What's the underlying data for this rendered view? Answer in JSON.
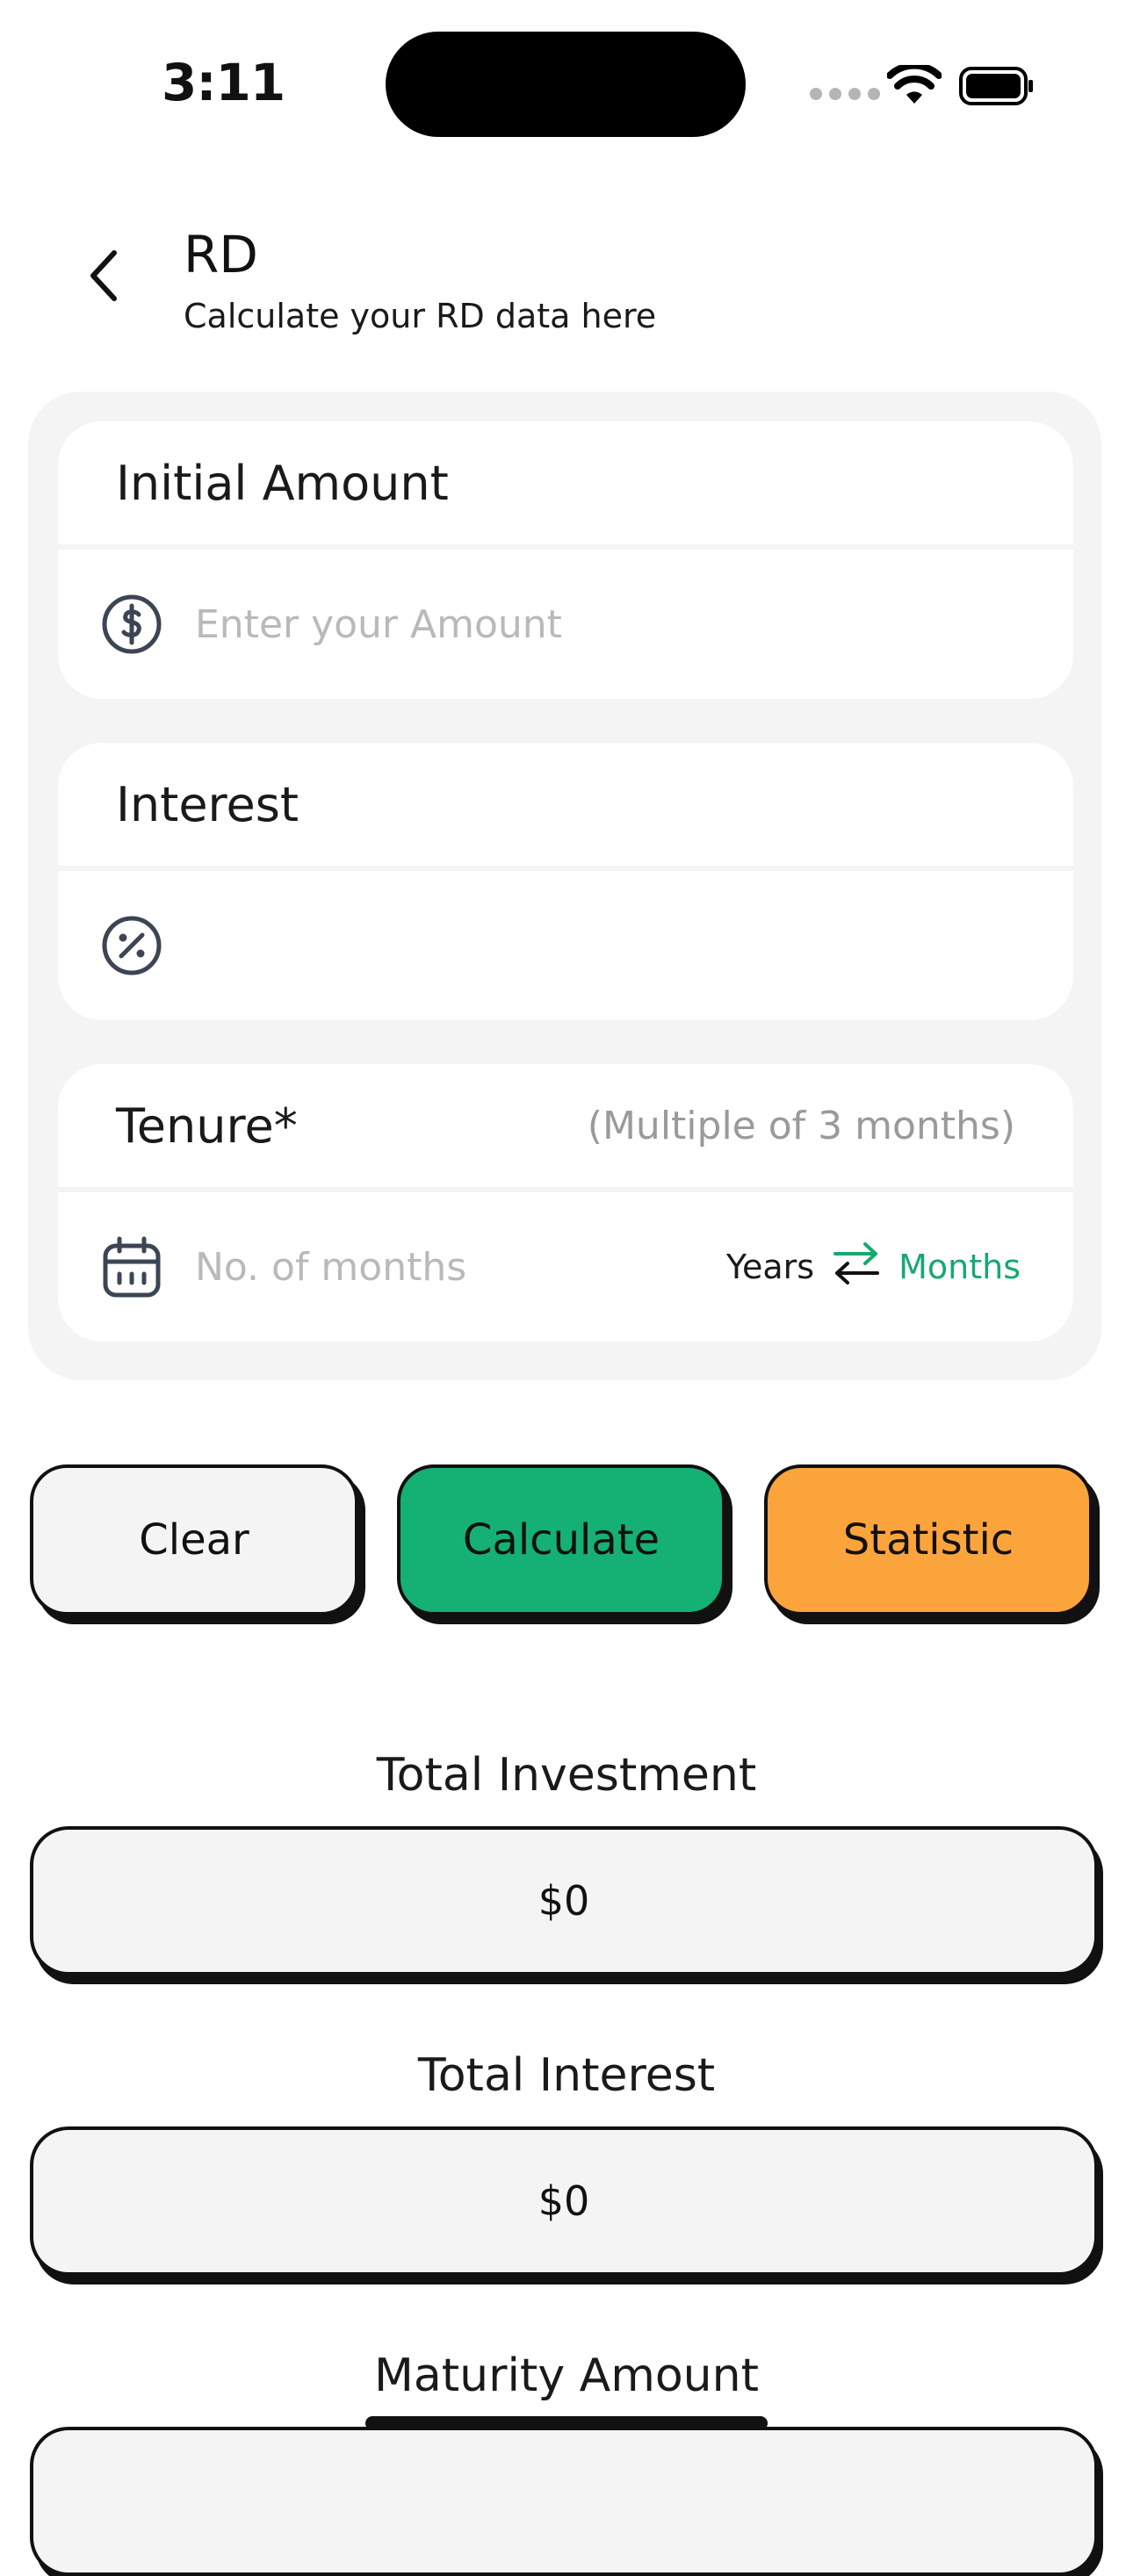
{
  "status_bar": {
    "time": "3:11",
    "icons": [
      "signal-icon",
      "wifi-icon",
      "battery-icon"
    ]
  },
  "header": {
    "title": "RD",
    "subtitle": "Calculate your RD data here",
    "back_icon": "chevron-left-icon"
  },
  "form": {
    "initial_amount": {
      "label": "Initial Amount",
      "placeholder": "Enter your Amount",
      "value": "",
      "icon": "dollar-circle-icon"
    },
    "interest": {
      "label": "Interest",
      "placeholder": "",
      "value": "",
      "icon": "percent-circle-icon"
    },
    "tenure": {
      "label": "Tenure*",
      "hint": "(Multiple of 3 months)",
      "placeholder": "No. of months",
      "value": "",
      "icon": "calendar-icon",
      "unit_years": "Years",
      "unit_months": "Months",
      "swap_icon": "swap-arrows-icon",
      "active_unit": "Months"
    }
  },
  "actions": {
    "clear_label": "Clear",
    "calculate_label": "Calculate",
    "statistic_label": "Statistic"
  },
  "results": {
    "total_investment_label": "Total Investment",
    "total_investment_value": "$0",
    "total_interest_label": "Total Interest",
    "total_interest_value": "$0",
    "maturity_amount_label": "Maturity Amount"
  },
  "colors": {
    "accent_green": "#15b074",
    "accent_orange": "#fca43c",
    "active_unit": "#17a86f",
    "panel_bg": "#f4f4f4"
  }
}
